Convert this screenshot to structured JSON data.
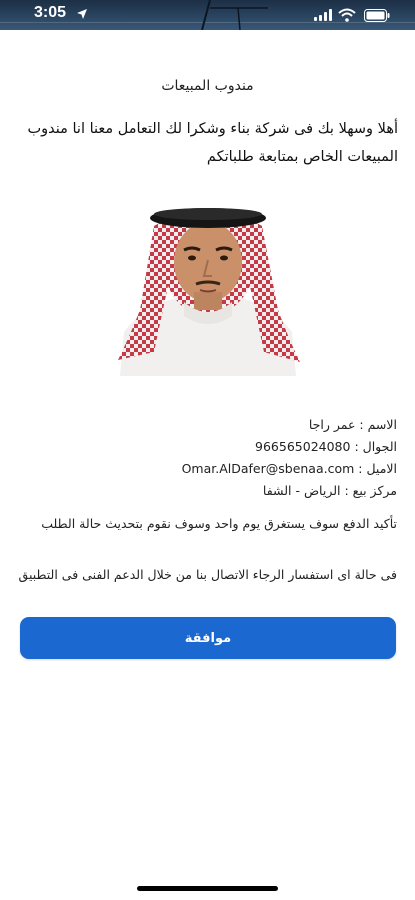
{
  "status_bar": {
    "time": "3:05"
  },
  "page": {
    "title": "مندوب المبيعات",
    "welcome": "أهلا وسهلا بك فى شركة بناء وشكرا لك التعامل معنا انا مندوب المبيعات الخاص بمتابعة طلباتكم"
  },
  "agent": {
    "name_line": "الاسم : عمر راجا",
    "phone_line": "الجوال : 966565024080",
    "email_line": "الاميل : Omar.AlDafer@sbenaa.com",
    "center_line": "مركز بيع : الرياض - الشفا"
  },
  "notes": {
    "payment_confirmation": "تأكيد الدفع سوف يستغرق يوم واحد وسوف نقوم بتحديث حالة الطلب",
    "support": "فى حالة اى استفسار الرجاء الاتصال بنا من خلال الدعم الفنى فى التطبيق"
  },
  "actions": {
    "agree_label": "موافقة"
  }
}
